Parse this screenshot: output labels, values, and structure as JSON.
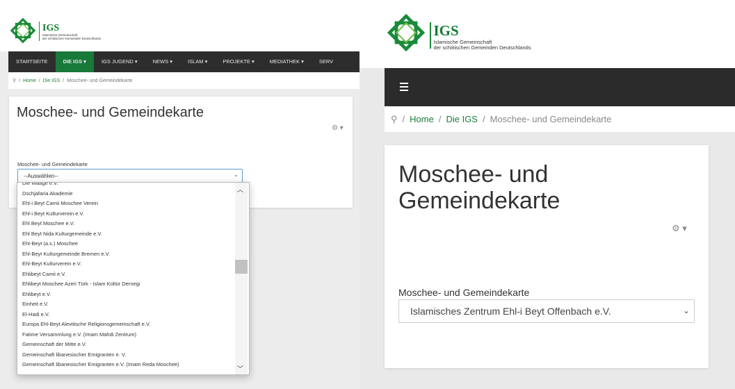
{
  "brand": {
    "title": "IGS",
    "subtitle_line1": "Islamische Gemeinschaft",
    "subtitle_line2": "der schiitischen Gemeinden Deutschlands",
    "green": "#1a8a3a"
  },
  "left": {
    "nav": [
      "STARTSEITE",
      "DIE IGS ▾",
      "IGS JUGEND ▾",
      "NEWS ▾",
      "ISLAM ▾",
      "PROJEKTE ▾",
      "MEDIATHEK ▾",
      "SERV"
    ],
    "nav_active_index": 1,
    "breadcrumb": {
      "home": "Home",
      "section": "Die IGS",
      "current": "Moschee- und Gemeindekarte",
      "sep": "/"
    },
    "page_title": "Moschee- und Gemeindekarte",
    "gear": "⚙ ▾",
    "field_label": "Moschee- und Gemeindekarte",
    "select_value": "--Auswählen--",
    "options": [
      "Die Waage e.V.",
      "Dschjafaria Akademie",
      "Ehl-i Beyt Camii Moschee Verein",
      "Ehl-i Beyt Kulturverein e.V.",
      "Ehl Beyt Moschee e.V.",
      "Ehl Beyt Nida Kulturgemeinde e.V.",
      "Ehl-Beyt (a.s.) Moschee",
      "Ehl-Beyt Kulturgemeinde Bremen e.V.",
      "Ehl-Beyt Kulturverein e.V.",
      "Ehlibeyt Camii e.V.",
      "Ehlibeyt Moschee Azeri Türk - Islam Kültür Dernegi",
      "Ehlibeyt e.V.",
      "Einheit e.V.",
      "El-Hadi e.V.",
      "Europa Ehl-Beyt Alevitische Religionsgemeinschaft e.V.",
      "Fatime Versammlung e.V. (Imam Mahdi Zentrum)",
      "Gemeinschaft der Mitte e.V.",
      "Gemeinschaft libanesischer Emigranten e. V.",
      "Gemeinschaft libanesischer Emigranten e.V. (Imam Reda Moschee)"
    ]
  },
  "right": {
    "breadcrumb": {
      "home": "Home",
      "section": "Die IGS",
      "current": "Moschee- und Gemeindekarte",
      "sep": "/"
    },
    "page_title_line1": "Moschee- und",
    "page_title_line2": "Gemeindekarte",
    "gear": "⚙ ▾",
    "field_label": "Moschee- und Gemeindekarte",
    "select_value": "Islamisches Zentrum Ehl-i Beyt Offenbach e.V."
  }
}
